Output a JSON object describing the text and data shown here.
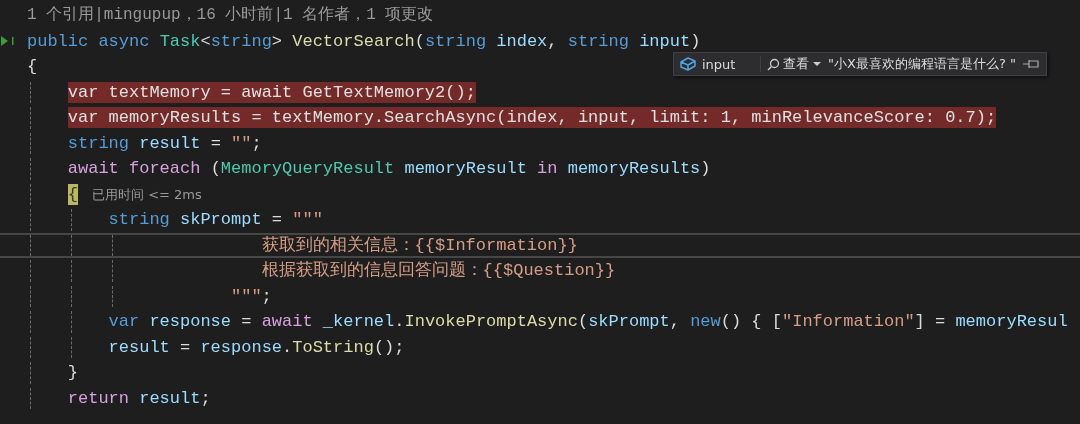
{
  "editor": {
    "lines": [
      {
        "kind": "codelens",
        "highlighted": false,
        "current": false,
        "gutter_marker": false,
        "tokens": [
          {
            "text": "1 个引用|mingupup，16 小时前|1 名作者，1 项更改",
            "kind": "lens"
          }
        ]
      },
      {
        "kind": "code",
        "highlighted": false,
        "current": false,
        "gutter_marker": true,
        "tokens": [
          {
            "text": "public async ",
            "kind": "keyword"
          },
          {
            "text": "Task",
            "kind": "type"
          },
          {
            "text": "<",
            "kind": "plain"
          },
          {
            "text": "string",
            "kind": "keyword"
          },
          {
            "text": "> ",
            "kind": "plain"
          },
          {
            "text": "VectorSearch",
            "kind": "method"
          },
          {
            "text": "(",
            "kind": "plain"
          },
          {
            "text": "string ",
            "kind": "keyword"
          },
          {
            "text": "index",
            "kind": "variable"
          },
          {
            "text": ", ",
            "kind": "plain"
          },
          {
            "text": "string ",
            "kind": "keyword"
          },
          {
            "text": "input",
            "kind": "variable"
          },
          {
            "text": ")",
            "kind": "plain"
          }
        ]
      },
      {
        "kind": "code",
        "highlighted": false,
        "current": false,
        "gutter_marker": false,
        "tokens": [
          {
            "text": "{",
            "kind": "plain"
          }
        ]
      },
      {
        "kind": "code",
        "highlighted": true,
        "current": false,
        "gutter_marker": false,
        "tokens": [
          {
            "text": "var textMemory = await GetTextMemory2();",
            "kind": "plain"
          }
        ]
      },
      {
        "kind": "code",
        "highlighted": true,
        "current": false,
        "gutter_marker": false,
        "tokens": [
          {
            "text": "var memoryResults = textMemory.SearchAsync(index, input, limit: 1, minRelevanceScore: 0.7);",
            "kind": "plain"
          }
        ]
      },
      {
        "kind": "code",
        "highlighted": false,
        "current": false,
        "gutter_marker": false,
        "tokens": [
          {
            "text": "string ",
            "kind": "keyword"
          },
          {
            "text": "result",
            "kind": "variable"
          },
          {
            "text": " = ",
            "kind": "plain"
          },
          {
            "text": "\"\"",
            "kind": "string"
          },
          {
            "text": ";",
            "kind": "plain"
          }
        ]
      },
      {
        "kind": "code",
        "highlighted": false,
        "current": false,
        "gutter_marker": false,
        "tokens": [
          {
            "text": "await foreach ",
            "kind": "control"
          },
          {
            "text": "(",
            "kind": "plain"
          },
          {
            "text": "MemoryQueryResult ",
            "kind": "type"
          },
          {
            "text": "memoryResult ",
            "kind": "variable"
          },
          {
            "text": "in ",
            "kind": "control"
          },
          {
            "text": "memoryResults",
            "kind": "variable"
          },
          {
            "text": ")",
            "kind": "plain"
          }
        ]
      },
      {
        "kind": "code",
        "highlighted": false,
        "current": false,
        "gutter_marker": false,
        "tokens": [
          {
            "text": "{",
            "kind": "brace_match"
          },
          {
            "text": "已用时间 <= 2ms",
            "kind": "hint"
          }
        ]
      },
      {
        "kind": "code",
        "highlighted": false,
        "current": false,
        "gutter_marker": false,
        "tokens": [
          {
            "text": "string ",
            "kind": "keyword"
          },
          {
            "text": "skPrompt",
            "kind": "variable"
          },
          {
            "text": " = ",
            "kind": "plain"
          },
          {
            "text": "\"\"\"",
            "kind": "string"
          }
        ]
      },
      {
        "kind": "code",
        "highlighted": false,
        "current": true,
        "gutter_marker": false,
        "tokens": [
          {
            "text": "获取到的相关信息：{{$Information}}",
            "kind": "string"
          }
        ]
      },
      {
        "kind": "code",
        "highlighted": false,
        "current": false,
        "gutter_marker": false,
        "tokens": [
          {
            "text": "根据获取到的信息回答问题：{{$Question}}",
            "kind": "string"
          }
        ]
      },
      {
        "kind": "code",
        "highlighted": false,
        "current": false,
        "gutter_marker": false,
        "tokens": [
          {
            "text": "\"\"\"",
            "kind": "string"
          },
          {
            "text": ";",
            "kind": "plain"
          }
        ]
      },
      {
        "kind": "code",
        "highlighted": false,
        "current": false,
        "gutter_marker": false,
        "tokens": [
          {
            "text": "var ",
            "kind": "keyword"
          },
          {
            "text": "response",
            "kind": "variable"
          },
          {
            "text": " = ",
            "kind": "plain"
          },
          {
            "text": "await ",
            "kind": "control"
          },
          {
            "text": "_kernel",
            "kind": "variable"
          },
          {
            "text": ".",
            "kind": "plain"
          },
          {
            "text": "InvokePromptAsync",
            "kind": "method"
          },
          {
            "text": "(",
            "kind": "plain"
          },
          {
            "text": "skPrompt",
            "kind": "variable"
          },
          {
            "text": ", ",
            "kind": "plain"
          },
          {
            "text": "new",
            "kind": "keyword"
          },
          {
            "text": "() { [",
            "kind": "plain"
          },
          {
            "text": "\"Information\"",
            "kind": "string"
          },
          {
            "text": "] = ",
            "kind": "plain"
          },
          {
            "text": "memoryResul",
            "kind": "variable"
          }
        ]
      },
      {
        "kind": "code",
        "highlighted": false,
        "current": false,
        "gutter_marker": false,
        "tokens": [
          {
            "text": "result",
            "kind": "variable"
          },
          {
            "text": " = ",
            "kind": "plain"
          },
          {
            "text": "response",
            "kind": "variable"
          },
          {
            "text": ".",
            "kind": "plain"
          },
          {
            "text": "ToString",
            "kind": "method"
          },
          {
            "text": "();",
            "kind": "plain"
          }
        ]
      },
      {
        "kind": "code",
        "highlighted": false,
        "current": false,
        "gutter_marker": false,
        "tokens": [
          {
            "text": "}",
            "kind": "plain"
          }
        ]
      },
      {
        "kind": "code",
        "highlighted": false,
        "current": false,
        "gutter_marker": false,
        "tokens": [
          {
            "text": "return ",
            "kind": "control"
          },
          {
            "text": "result",
            "kind": "variable"
          },
          {
            "text": ";",
            "kind": "plain"
          }
        ]
      }
    ]
  },
  "datatip": {
    "name": "input",
    "action": "查看",
    "value": "\"小X最喜欢的编程语言是什么? \""
  }
}
